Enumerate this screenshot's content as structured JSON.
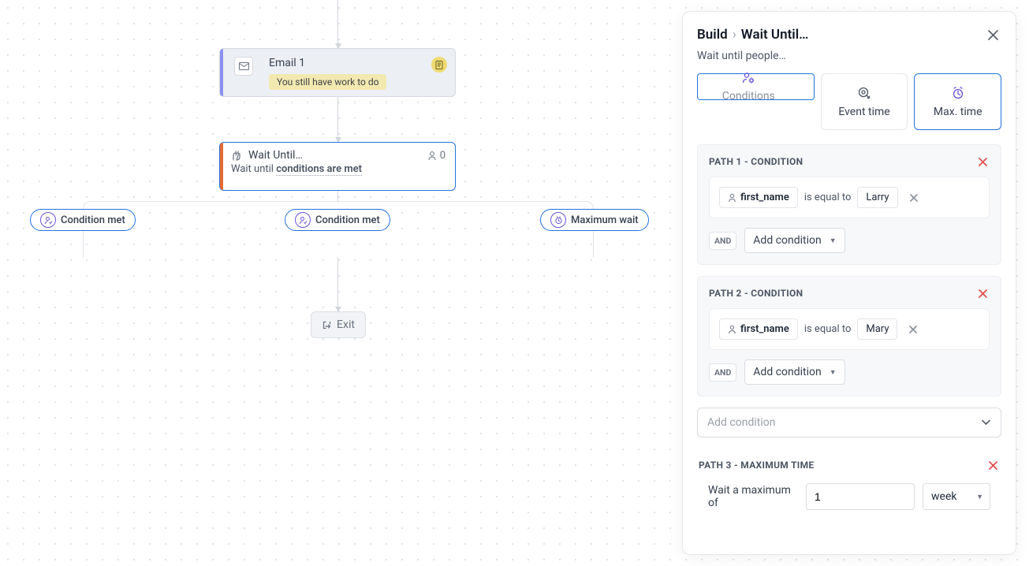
{
  "canvas": {
    "email_node": {
      "title": "Email 1",
      "subject_chip": "You still have work to do"
    },
    "wait_node": {
      "title": "Wait Until…",
      "desc_prefix": "Wait until ",
      "desc_bold": "conditions are met",
      "count": "0"
    },
    "branches": {
      "b1": "Condition met",
      "b2": "Condition met",
      "b3": "Maximum wait"
    },
    "exit_label": "Exit"
  },
  "panel": {
    "crumb_root": "Build",
    "crumb_sep": "›",
    "crumb_leaf": "Wait Until…",
    "subtitle": "Wait until people…",
    "tabs": {
      "conditions": "Conditions",
      "event_time": "Event time",
      "max_time": "Max. time"
    },
    "paths": {
      "p1": {
        "header": "PATH 1 - CONDITION",
        "field": "first_name",
        "operator": "is equal to",
        "value": "Larry",
        "and": "AND",
        "add": "Add condition"
      },
      "p2": {
        "header": "PATH 2 - CONDITION",
        "field": "first_name",
        "operator": "is equal to",
        "value": "Mary",
        "and": "AND",
        "add": "Add condition"
      },
      "big_add": "Add condition",
      "p3": {
        "header": "PATH 3 - MAXIMUM TIME",
        "prefix": "Wait a maximum of",
        "value": "1",
        "unit": "week"
      }
    }
  }
}
